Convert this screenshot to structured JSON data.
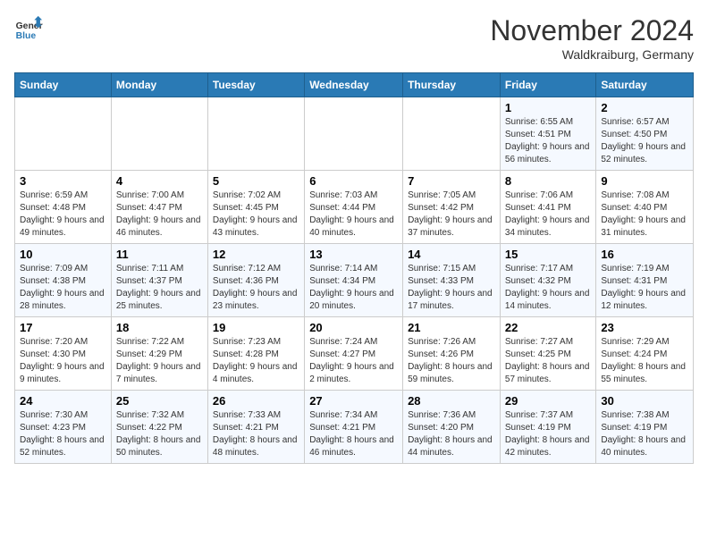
{
  "logo": {
    "line1": "General",
    "line2": "Blue"
  },
  "title": "November 2024",
  "location": "Waldkraiburg, Germany",
  "columns": [
    "Sunday",
    "Monday",
    "Tuesday",
    "Wednesday",
    "Thursday",
    "Friday",
    "Saturday"
  ],
  "weeks": [
    [
      {
        "day": "",
        "info": ""
      },
      {
        "day": "",
        "info": ""
      },
      {
        "day": "",
        "info": ""
      },
      {
        "day": "",
        "info": ""
      },
      {
        "day": "",
        "info": ""
      },
      {
        "day": "1",
        "info": "Sunrise: 6:55 AM\nSunset: 4:51 PM\nDaylight: 9 hours and 56 minutes."
      },
      {
        "day": "2",
        "info": "Sunrise: 6:57 AM\nSunset: 4:50 PM\nDaylight: 9 hours and 52 minutes."
      }
    ],
    [
      {
        "day": "3",
        "info": "Sunrise: 6:59 AM\nSunset: 4:48 PM\nDaylight: 9 hours and 49 minutes."
      },
      {
        "day": "4",
        "info": "Sunrise: 7:00 AM\nSunset: 4:47 PM\nDaylight: 9 hours and 46 minutes."
      },
      {
        "day": "5",
        "info": "Sunrise: 7:02 AM\nSunset: 4:45 PM\nDaylight: 9 hours and 43 minutes."
      },
      {
        "day": "6",
        "info": "Sunrise: 7:03 AM\nSunset: 4:44 PM\nDaylight: 9 hours and 40 minutes."
      },
      {
        "day": "7",
        "info": "Sunrise: 7:05 AM\nSunset: 4:42 PM\nDaylight: 9 hours and 37 minutes."
      },
      {
        "day": "8",
        "info": "Sunrise: 7:06 AM\nSunset: 4:41 PM\nDaylight: 9 hours and 34 minutes."
      },
      {
        "day": "9",
        "info": "Sunrise: 7:08 AM\nSunset: 4:40 PM\nDaylight: 9 hours and 31 minutes."
      }
    ],
    [
      {
        "day": "10",
        "info": "Sunrise: 7:09 AM\nSunset: 4:38 PM\nDaylight: 9 hours and 28 minutes."
      },
      {
        "day": "11",
        "info": "Sunrise: 7:11 AM\nSunset: 4:37 PM\nDaylight: 9 hours and 25 minutes."
      },
      {
        "day": "12",
        "info": "Sunrise: 7:12 AM\nSunset: 4:36 PM\nDaylight: 9 hours and 23 minutes."
      },
      {
        "day": "13",
        "info": "Sunrise: 7:14 AM\nSunset: 4:34 PM\nDaylight: 9 hours and 20 minutes."
      },
      {
        "day": "14",
        "info": "Sunrise: 7:15 AM\nSunset: 4:33 PM\nDaylight: 9 hours and 17 minutes."
      },
      {
        "day": "15",
        "info": "Sunrise: 7:17 AM\nSunset: 4:32 PM\nDaylight: 9 hours and 14 minutes."
      },
      {
        "day": "16",
        "info": "Sunrise: 7:19 AM\nSunset: 4:31 PM\nDaylight: 9 hours and 12 minutes."
      }
    ],
    [
      {
        "day": "17",
        "info": "Sunrise: 7:20 AM\nSunset: 4:30 PM\nDaylight: 9 hours and 9 minutes."
      },
      {
        "day": "18",
        "info": "Sunrise: 7:22 AM\nSunset: 4:29 PM\nDaylight: 9 hours and 7 minutes."
      },
      {
        "day": "19",
        "info": "Sunrise: 7:23 AM\nSunset: 4:28 PM\nDaylight: 9 hours and 4 minutes."
      },
      {
        "day": "20",
        "info": "Sunrise: 7:24 AM\nSunset: 4:27 PM\nDaylight: 9 hours and 2 minutes."
      },
      {
        "day": "21",
        "info": "Sunrise: 7:26 AM\nSunset: 4:26 PM\nDaylight: 8 hours and 59 minutes."
      },
      {
        "day": "22",
        "info": "Sunrise: 7:27 AM\nSunset: 4:25 PM\nDaylight: 8 hours and 57 minutes."
      },
      {
        "day": "23",
        "info": "Sunrise: 7:29 AM\nSunset: 4:24 PM\nDaylight: 8 hours and 55 minutes."
      }
    ],
    [
      {
        "day": "24",
        "info": "Sunrise: 7:30 AM\nSunset: 4:23 PM\nDaylight: 8 hours and 52 minutes."
      },
      {
        "day": "25",
        "info": "Sunrise: 7:32 AM\nSunset: 4:22 PM\nDaylight: 8 hours and 50 minutes."
      },
      {
        "day": "26",
        "info": "Sunrise: 7:33 AM\nSunset: 4:21 PM\nDaylight: 8 hours and 48 minutes."
      },
      {
        "day": "27",
        "info": "Sunrise: 7:34 AM\nSunset: 4:21 PM\nDaylight: 8 hours and 46 minutes."
      },
      {
        "day": "28",
        "info": "Sunrise: 7:36 AM\nSunset: 4:20 PM\nDaylight: 8 hours and 44 minutes."
      },
      {
        "day": "29",
        "info": "Sunrise: 7:37 AM\nSunset: 4:19 PM\nDaylight: 8 hours and 42 minutes."
      },
      {
        "day": "30",
        "info": "Sunrise: 7:38 AM\nSunset: 4:19 PM\nDaylight: 8 hours and 40 minutes."
      }
    ]
  ]
}
